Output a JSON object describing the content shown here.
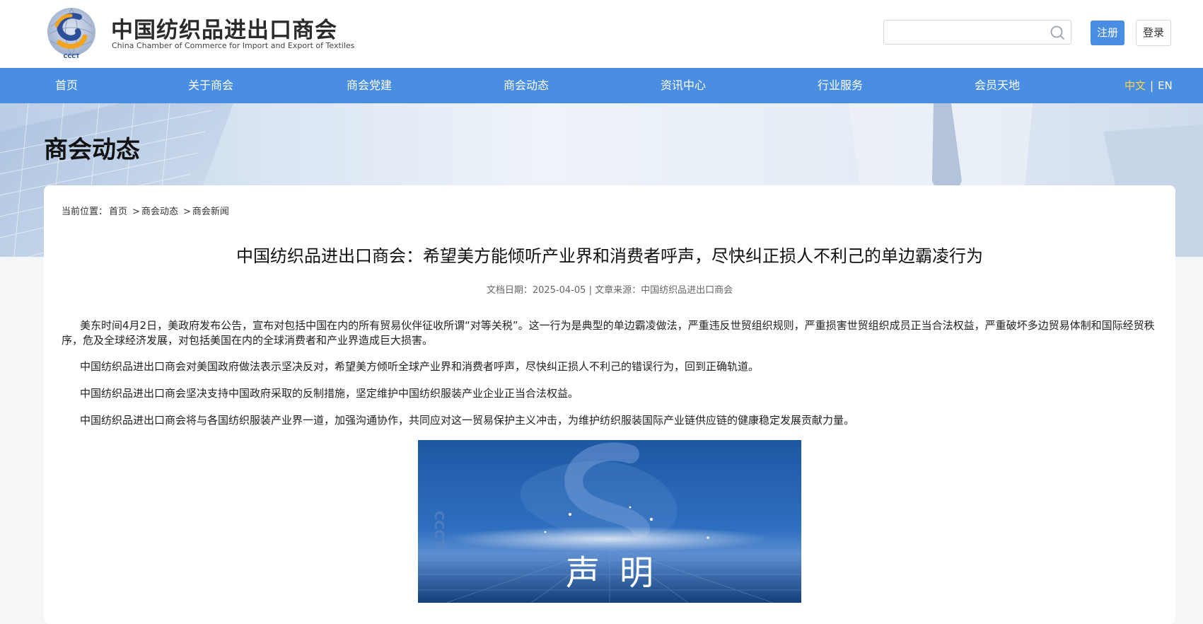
{
  "header": {
    "brand_cn": "中国纺织品进出口商会",
    "brand_en": "China Chamber of Commerce for Import and Export of Textiles",
    "logo_text": "CCCT",
    "search_placeholder": "",
    "register_label": "注册",
    "login_label": "登录"
  },
  "nav": {
    "items": [
      "首页",
      "关于商会",
      "商会党建",
      "商会动态",
      "资讯中心",
      "行业服务",
      "会员天地"
    ],
    "lang_cn": "中文",
    "lang_sep": "|",
    "lang_en": "EN"
  },
  "banner": {
    "title": "商会动态"
  },
  "breadcrumb": {
    "prefix": "当前位置：",
    "items": [
      "首页",
      "商会动态",
      "商会新闻"
    ],
    "separator": ">"
  },
  "article": {
    "title": "中国纺织品进出口商会：希望美方能倾听产业界和消费者呼声，尽快纠正损人不利己的单边霸凌行为",
    "meta": "文档日期：2025-04-05 | 文章来源：中国纺织品进出口商会",
    "paragraphs": [
      "美东时间4月2日，美政府发布公告，宣布对包括中国在内的所有贸易伙伴征收所谓“对等关税”。这一行为是典型的单边霸凌做法，严重违反世贸组织规则，严重损害世贸组织成员正当合法权益，严重破坏多边贸易体制和国际经贸秩序，危及全球经济发展，对包括美国在内的全球消费者和产业界造成巨大损害。",
      "中国纺织品进出口商会对美国政府做法表示坚决反对，希望美方倾听全球产业界和消费者呼声，尽快纠正损人不利己的错误行为，回到正确轨道。",
      "中国纺织品进出口商会坚决支持中国政府采取的反制措施，坚定维护中国纺织服装产业企业正当合法权益。",
      "中国纺织品进出口商会将与各国纺织服装产业界一道，加强沟通协作，共同应对这一贸易保护主义冲击，为维护纺织服装国际产业链供应链的健康稳定发展贡献力量。"
    ],
    "image_caption": "声明",
    "image_watermark": "CCCT"
  },
  "colors": {
    "brand_blue": "#4a8ee3",
    "lang_active": "#ffd54a",
    "statement_bg": "#1e5aa6"
  }
}
